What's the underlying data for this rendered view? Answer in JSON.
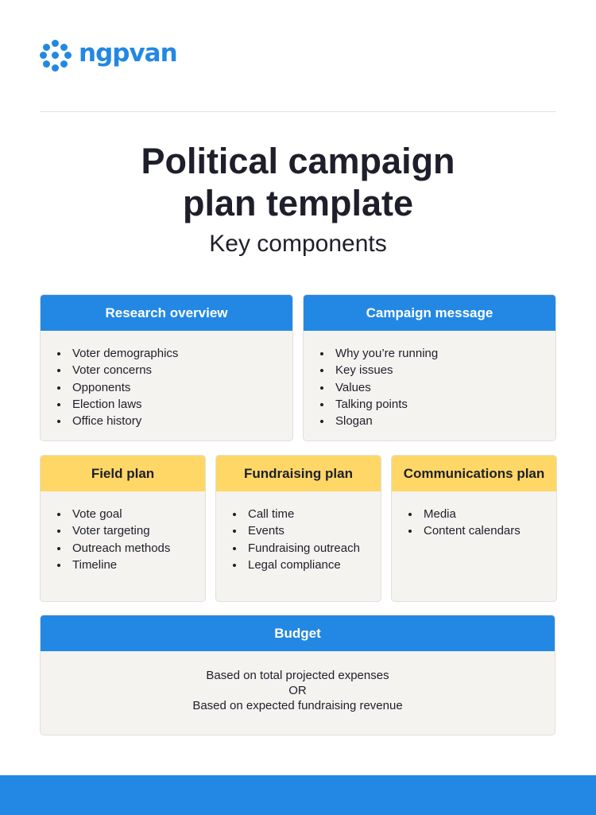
{
  "brand": {
    "name": "ngpvan",
    "color": "#2388e3"
  },
  "header": {
    "title": "Political campaign plan template",
    "title_line1": "Political campaign",
    "title_line2": "plan template",
    "subtitle": "Key components"
  },
  "colors": {
    "blue": "#2388e3",
    "yellow": "#fed766",
    "card_bg": "#f4f3f0",
    "text": "#1f1f2b"
  },
  "sections": {
    "research": {
      "title": "Research overview",
      "items": [
        "Voter demographics",
        "Voter concerns",
        "Opponents",
        "Election laws",
        "Office history"
      ]
    },
    "message": {
      "title": "Campaign message",
      "items": [
        "Why you’re running",
        "Key issues",
        "Values",
        "Talking points",
        "Slogan"
      ]
    },
    "field": {
      "title": "Field plan",
      "items": [
        "Vote goal",
        "Voter targeting",
        "Outreach methods",
        "Timeline"
      ]
    },
    "fundraising": {
      "title": "Fundraising plan",
      "items": [
        "Call time",
        "Events",
        "Fundraising outreach",
        "Legal compliance"
      ]
    },
    "communications": {
      "title": "Communications plan",
      "items": [
        "Media",
        "Content calendars"
      ]
    },
    "budget": {
      "title": "Budget",
      "lines": [
        "Based on total projected expenses",
        "OR",
        "Based on expected fundraising revenue"
      ]
    }
  }
}
